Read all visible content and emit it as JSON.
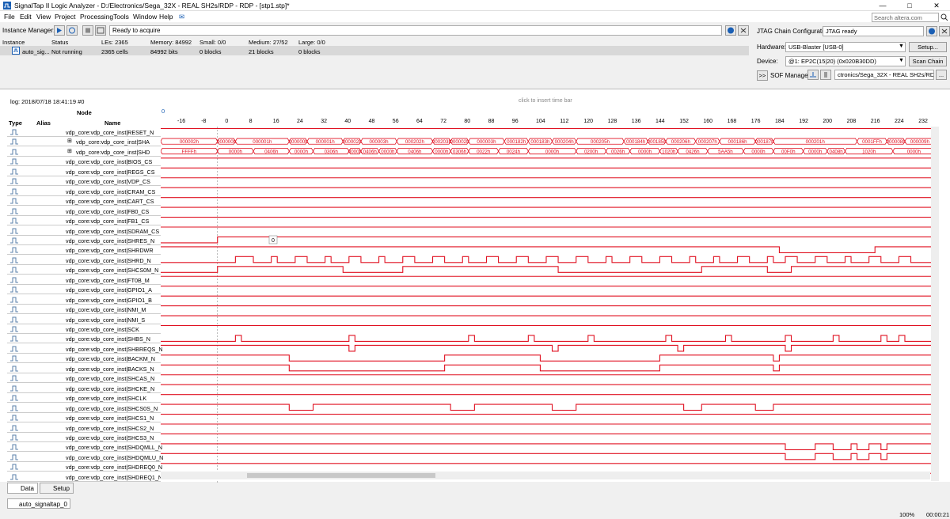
{
  "window": {
    "title": "SignalTap II Logic Analyzer - D:/Electronics/Sega_32X - REAL SH2s/RDP - RDP - [stp1.stp]*"
  },
  "menu": [
    "File",
    "Edit",
    "View",
    "Project",
    "Processing",
    "Tools",
    "Window",
    "Help"
  ],
  "search": {
    "placeholder": "Search altera.com"
  },
  "instance_manager": {
    "label": "Instance Manager:",
    "status": "Ready to acquire",
    "headers": [
      "Instance",
      "Status",
      "LEs: 2365",
      "Memory: 84992",
      "Small: 0/0",
      "Medium: 27/52",
      "Large: 0/0"
    ],
    "row": [
      "auto_sig...",
      "Not running",
      "2365 cells",
      "84992 bits",
      "0 blocks",
      "21 blocks",
      "0 blocks"
    ]
  },
  "jtag": {
    "label": "JTAG Chain Configuration:",
    "status": "JTAG ready",
    "hardware_label": "Hardware:",
    "hardware": "USB-Blaster [USB-0]",
    "setup": "Setup...",
    "device_label": "Device:",
    "device": "@1: EP2C(15|20) (0x020B30DD)",
    "scan": "Scan Chain",
    "sof_toggle": ">>",
    "sof_label": "SOF Manager:",
    "sof_file": "ctronics/Sega_32X - REAL SH2s/RDP.sof",
    "sof_browse": "..."
  },
  "log": {
    "text": "log: 2018/07/18 18:41:19  #0",
    "hint": "click to insert time bar",
    "marker": "0"
  },
  "columns": {
    "node": "Node",
    "type": "Type",
    "alias": "Alias",
    "name": "Name"
  },
  "timescale": [
    "-16",
    "-8",
    "0",
    "8",
    "16",
    "24",
    "32",
    "40",
    "48",
    "56",
    "64",
    "72",
    "80",
    "88",
    "96",
    "104",
    "112",
    "120",
    "128",
    "136",
    "144",
    "152",
    "160",
    "168",
    "176",
    "184",
    "192",
    "200",
    "208",
    "216",
    "224",
    "232"
  ],
  "signals": [
    "vdp_core:vdp_core_inst|RESET_N",
    "vdp_core:vdp_core_inst|SHA",
    "vdp_core:vdp_core_inst|SHD",
    "vdp_core:vdp_core_inst|BIOS_CS",
    "vdp_core:vdp_core_inst|REGS_CS",
    "vdp_core:vdp_core_inst|VDP_CS",
    "vdp_core:vdp_core_inst|CRAM_CS",
    "vdp_core:vdp_core_inst|CART_CS",
    "vdp_core:vdp_core_inst|FB0_CS",
    "vdp_core:vdp_core_inst|FB1_CS",
    "vdp_core:vdp_core_inst|SDRAM_CS",
    "vdp_core:vdp_core_inst|SHRES_N",
    "vdp_core:vdp_core_inst|SHRDWR",
    "vdp_core:vdp_core_inst|SHRD_N",
    "vdp_core:vdp_core_inst|SHCS0M_N",
    "vdp_core:vdp_core_inst|FT0B_M",
    "vdp_core:vdp_core_inst|GPIO1_A",
    "vdp_core:vdp_core_inst|GPIO1_B",
    "vdp_core:vdp_core_inst|NMI_M",
    "vdp_core:vdp_core_inst|NMI_S",
    "vdp_core:vdp_core_inst|SCK",
    "vdp_core:vdp_core_inst|SHBS_N",
    "vdp_core:vdp_core_inst|SHBREQS_N",
    "vdp_core:vdp_core_inst|BACKM_N",
    "vdp_core:vdp_core_inst|BACKS_N",
    "vdp_core:vdp_core_inst|SHCAS_N",
    "vdp_core:vdp_core_inst|SHCKE_N",
    "vdp_core:vdp_core_inst|SHCLK",
    "vdp_core:vdp_core_inst|SHCS0S_N",
    "vdp_core:vdp_core_inst|SHCS1_N",
    "vdp_core:vdp_core_inst|SHCS2_N",
    "vdp_core:vdp_core_inst|SHCS3_N",
    "vdp_core:vdp_core_inst|SHDQMLL_N",
    "vdp_core:vdp_core_inst|SHDQMLU_N",
    "vdp_core:vdp_core_inst|SHDREQ0_N",
    "vdp_core:vdp_core_inst|SHDREQ1_N"
  ],
  "bus_sha": [
    "000002h",
    "000000h",
    "000001h",
    "000000h",
    "000001h",
    "000002h",
    "000003h",
    "000202h",
    "000203h",
    "000002h",
    "000003h",
    "000182h",
    "000183h",
    "000204h",
    "000205h",
    "000184h",
    "000185h",
    "000206h",
    "000207h",
    "000186h",
    "000187h",
    "000201h",
    "0001FFh",
    "000008h",
    "000009h"
  ],
  "bus_shd": [
    "FFFFh",
    "0000h",
    "0406h",
    "0000h",
    "0306h",
    "0000h",
    "0406h",
    "0000h",
    "0406h",
    "0000h",
    "0306h",
    "0022h",
    "0024h",
    "0000h",
    "0200h",
    "0026h",
    "0000h",
    "1020h",
    "0426h",
    "5AA5h",
    "0000h",
    "00F0h",
    "0000h",
    "0408h",
    "1020h",
    "0000h"
  ],
  "tooltip_value": "0",
  "tabs": {
    "data": "Data",
    "setup": "Setup"
  },
  "bottom": {
    "instance_tab": "auto_signaltap_0",
    "zoom": "100%",
    "elapsed": "00:00:21"
  },
  "colors": {
    "signal": "#e01020",
    "accent": "#1a5fb4"
  }
}
